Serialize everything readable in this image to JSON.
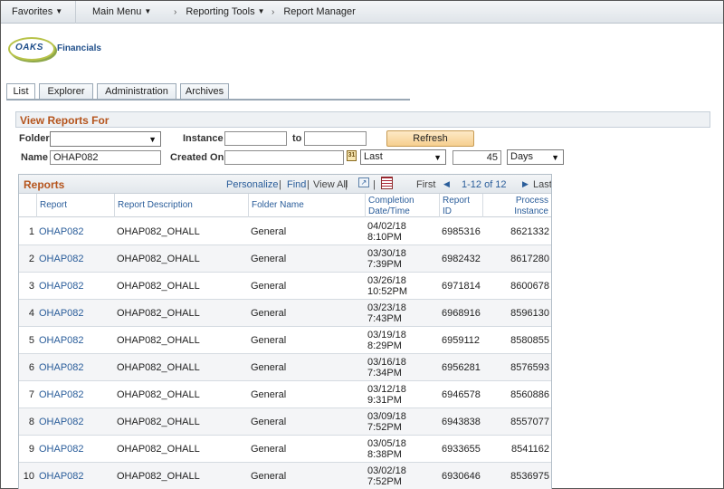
{
  "menu": {
    "favorites": "Favorites",
    "main_menu": "Main Menu",
    "reporting_tools": "Reporting Tools",
    "report_manager": "Report Manager"
  },
  "logo": {
    "oaks": "OAKS",
    "financials": "Financials"
  },
  "tabs": [
    "List",
    "Explorer",
    "Administration",
    "Archives"
  ],
  "filters": {
    "section_title": "View Reports For",
    "folder_label": "Folder",
    "folder_value": "",
    "instance_label": "Instance",
    "instance_from": "",
    "to_label": "to",
    "instance_to": "",
    "refresh_label": "Refresh",
    "name_label": "Name",
    "name_value": "OHAP082",
    "created_on_label": "Created On",
    "created_on_value": "",
    "range_value": "Last",
    "count_value": "45",
    "unit_value": "Days"
  },
  "grid": {
    "title": "Reports",
    "personalize": "Personalize",
    "find": "Find",
    "view_all": "View All",
    "first": "First",
    "range": "1-12 of 12",
    "last": "Last",
    "columns": {
      "report": "Report",
      "description": "Report Description",
      "folder": "Folder Name",
      "completion_1": "Completion",
      "completion_2": "Date/Time",
      "report_id_1": "Report",
      "report_id_2": "ID",
      "process_1": "Process",
      "process_2": "Instance"
    },
    "rows": [
      {
        "n": "1",
        "report": "OHAP082",
        "desc": "OHAP082_OHALL",
        "folder": "General",
        "date": "04/02/18",
        "time": "8:10PM",
        "id": "6985316",
        "instance": "8621332"
      },
      {
        "n": "2",
        "report": "OHAP082",
        "desc": "OHAP082_OHALL",
        "folder": "General",
        "date": "03/30/18",
        "time": "7:39PM",
        "id": "6982432",
        "instance": "8617280"
      },
      {
        "n": "3",
        "report": "OHAP082",
        "desc": "OHAP082_OHALL",
        "folder": "General",
        "date": "03/26/18",
        "time": "10:52PM",
        "id": "6971814",
        "instance": "8600678"
      },
      {
        "n": "4",
        "report": "OHAP082",
        "desc": "OHAP082_OHALL",
        "folder": "General",
        "date": "03/23/18",
        "time": "7:43PM",
        "id": "6968916",
        "instance": "8596130"
      },
      {
        "n": "5",
        "report": "OHAP082",
        "desc": "OHAP082_OHALL",
        "folder": "General",
        "date": "03/19/18",
        "time": "8:29PM",
        "id": "6959112",
        "instance": "8580855"
      },
      {
        "n": "6",
        "report": "OHAP082",
        "desc": "OHAP082_OHALL",
        "folder": "General",
        "date": "03/16/18",
        "time": "7:34PM",
        "id": "6956281",
        "instance": "8576593"
      },
      {
        "n": "7",
        "report": "OHAP082",
        "desc": "OHAP082_OHALL",
        "folder": "General",
        "date": "03/12/18",
        "time": "9:31PM",
        "id": "6946578",
        "instance": "8560886"
      },
      {
        "n": "8",
        "report": "OHAP082",
        "desc": "OHAP082_OHALL",
        "folder": "General",
        "date": "03/09/18",
        "time": "7:52PM",
        "id": "6943838",
        "instance": "8557077"
      },
      {
        "n": "9",
        "report": "OHAP082",
        "desc": "OHAP082_OHALL",
        "folder": "General",
        "date": "03/05/18",
        "time": "8:38PM",
        "id": "6933655",
        "instance": "8541162"
      },
      {
        "n": "10",
        "report": "OHAP082",
        "desc": "OHAP082_OHALL",
        "folder": "General",
        "date": "03/02/18",
        "time": "7:52PM",
        "id": "6930646",
        "instance": "8536975"
      }
    ]
  }
}
